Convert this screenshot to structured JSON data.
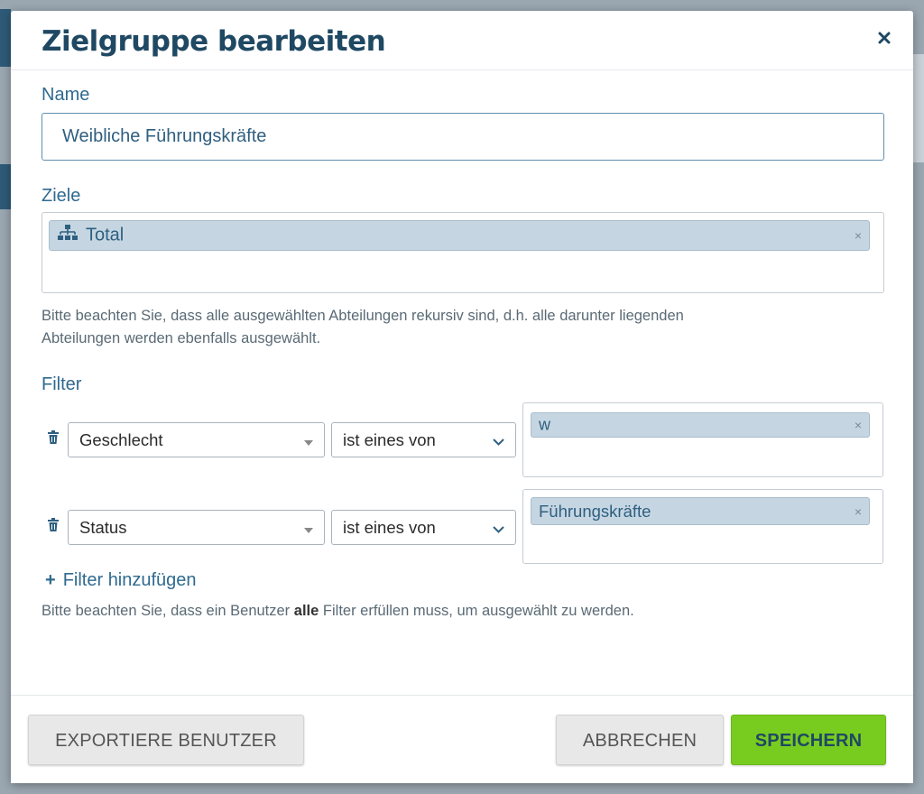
{
  "dialog": {
    "title": "Zielgruppe bearbeiten",
    "close_icon": "close-icon"
  },
  "name_field": {
    "label": "Name",
    "value": "Weibliche Führungskräfte"
  },
  "goals_field": {
    "label": "Ziele",
    "tags": [
      {
        "label": "Total",
        "icon": "org-chart-icon",
        "remove_label": "×"
      }
    ],
    "hint_line1": "Bitte beachten Sie, dass alle ausgewählten Abteilungen rekursiv sind, d.h. alle darunter liegenden",
    "hint_line2": "Abteilungen werden ebenfalls ausgewählt."
  },
  "filters": {
    "label": "Filter",
    "rows": [
      {
        "attribute": "Geschlecht",
        "operator": "ist eines von",
        "values": [
          {
            "label": "w",
            "remove_label": "×"
          }
        ]
      },
      {
        "attribute": "Status",
        "operator": "ist eines von",
        "values": [
          {
            "label": "Führungskräfte",
            "remove_label": "×"
          }
        ]
      }
    ],
    "add_label": "Filter hinzufügen",
    "add_icon": "+",
    "hint_before": "Bitte beachten Sie, dass ein Benutzer",
    "hint_bold": "alle",
    "hint_after": "Filter erfüllen muss, um ausgewählt zu werden."
  },
  "footer": {
    "export_label": "EXPORTIERE BENUTZER",
    "cancel_label": "ABBRECHEN",
    "save_label": "SPEICHERN"
  },
  "colors": {
    "title": "#1f4863",
    "label": "#2f6a8f",
    "tag_bg": "#c5d6e2",
    "save_bg": "#78cc1f"
  }
}
